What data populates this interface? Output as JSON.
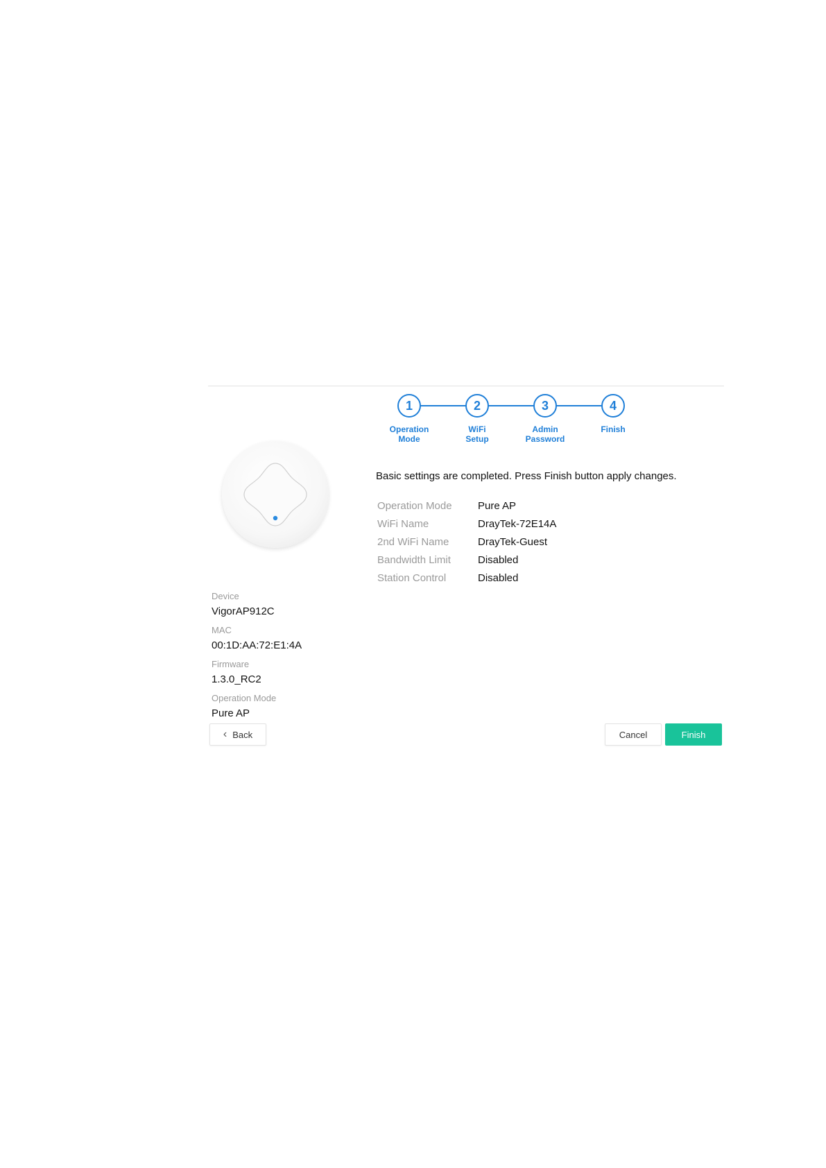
{
  "colors": {
    "accent": "#1f7fd8",
    "finish": "#19c39a",
    "label_gray": "#9a9a9a"
  },
  "stepper": {
    "steps": [
      {
        "number": "1",
        "label": "Operation\nMode"
      },
      {
        "number": "2",
        "label": "WiFi\nSetup"
      },
      {
        "number": "3",
        "label": "Admin\nPassword"
      },
      {
        "number": "4",
        "label": "Finish"
      }
    ]
  },
  "message": "Basic settings are completed. Press Finish button apply changes.",
  "summary": [
    {
      "key": "Operation Mode",
      "value": "Pure AP"
    },
    {
      "key": "WiFi Name",
      "value": "DrayTek-72E14A"
    },
    {
      "key": "2nd WiFi Name",
      "value": "DrayTek-Guest"
    },
    {
      "key": "Bandwidth Limit",
      "value": "Disabled"
    },
    {
      "key": "Station Control",
      "value": "Disabled"
    }
  ],
  "device_info": {
    "device_label": "Device",
    "device_value": "VigorAP912C",
    "mac_label": "MAC",
    "mac_value": "00:1D:AA:72:E1:4A",
    "firmware_label": "Firmware",
    "firmware_value": "1.3.0_RC2",
    "mode_label": "Operation Mode",
    "mode_value": "Pure AP"
  },
  "buttons": {
    "back": "Back",
    "back_icon": "chevron-left-icon",
    "cancel": "Cancel",
    "finish": "Finish"
  }
}
